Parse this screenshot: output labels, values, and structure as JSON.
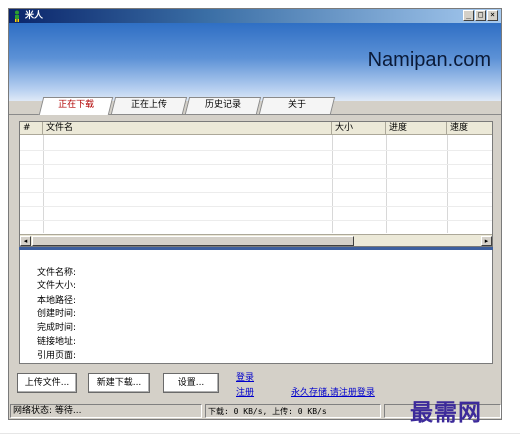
{
  "window": {
    "title": "米人",
    "brand": "Namipan.com",
    "controls": {
      "minimize": "_",
      "maximize": "□",
      "close": "×"
    }
  },
  "tabs": [
    {
      "label": "正在下载",
      "active": true
    },
    {
      "label": "正在上传",
      "active": false
    },
    {
      "label": "历史记录",
      "active": false
    },
    {
      "label": "关于",
      "active": false
    }
  ],
  "table": {
    "columns": [
      "#",
      "文件名",
      "大小",
      "进度",
      "速度"
    ],
    "rows": []
  },
  "details": {
    "labels": [
      "文件名称:",
      "文件大小:",
      "本地路径:",
      "创建时间:",
      "完成时间:",
      "链接地址:",
      "引用页面:"
    ]
  },
  "buttons": {
    "upload": "上传文件...",
    "new_download": "新建下载...",
    "settings": "设置..."
  },
  "links": {
    "login": "登录",
    "register": "注册",
    "permanent_storage": "永久存储,请注册登录"
  },
  "status": {
    "network": "网络状态: 等待...",
    "speed": "下载: 0 KB/s, 上传: 0 KB/s"
  },
  "watermark": "最需网",
  "colors": {
    "title_bar": "#0a246a",
    "active_tab_text": "#b00000",
    "link": "#0000cc",
    "watermark": "#3c2a9a"
  },
  "icons": {
    "app": "person-icon",
    "scroll_left": "arrow-left-icon",
    "scroll_right": "arrow-right-icon"
  }
}
